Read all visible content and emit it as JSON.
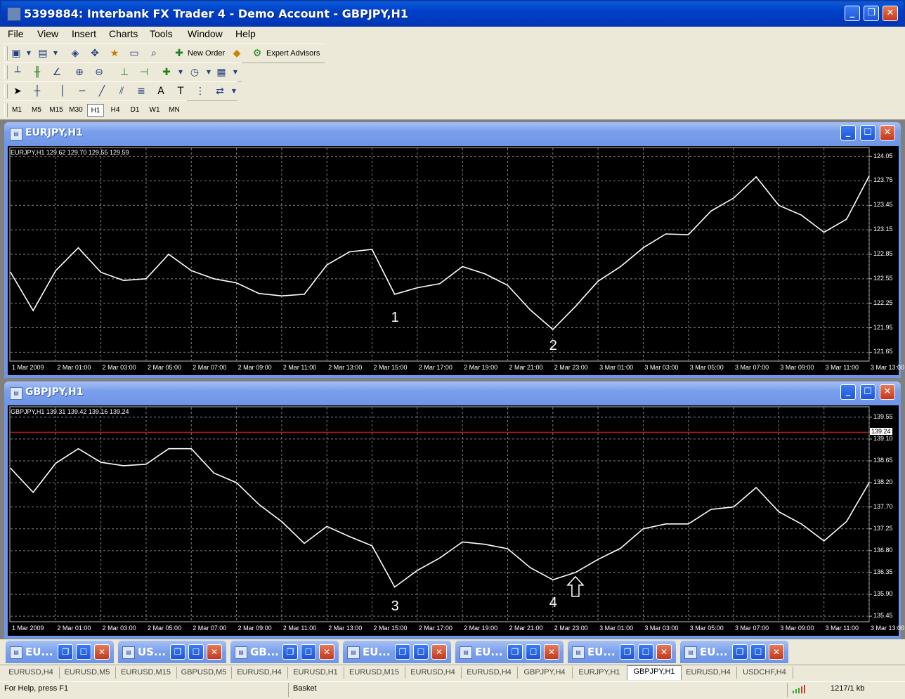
{
  "window": {
    "title": "5399884: Interbank FX Trader 4 - Demo Account - GBPJPY,H1",
    "min_label": "_",
    "restore_label": "❐",
    "close_label": "✕"
  },
  "menu": [
    "File",
    "View",
    "Insert",
    "Charts",
    "Tools",
    "Window",
    "Help"
  ],
  "toolbar1": {
    "new_order_label": "New Order",
    "expert_advisors_label": "Expert Advisors"
  },
  "toolbar_text": {
    "text_tool": "A",
    "text_label_tool": "T"
  },
  "timeframes": [
    "M1",
    "M5",
    "M15",
    "M30",
    "H1",
    "H4",
    "D1",
    "W1",
    "MN"
  ],
  "active_timeframe": "H1",
  "charts": [
    {
      "window_title": "EURJPY,H1",
      "info": "EURJPY,H1  129.62 129.70 129.55 129.59",
      "y_labels": [
        "124.05",
        "123.75",
        "123.45",
        "123.15",
        "122.85",
        "122.55",
        "122.25",
        "121.95",
        "121.65"
      ],
      "x_labels": [
        "1 Mar 2009",
        "2 Mar 01:00",
        "2 Mar 03:00",
        "2 Mar 05:00",
        "2 Mar 07:00",
        "2 Mar 09:00",
        "2 Mar 11:00",
        "2 Mar 13:00",
        "2 Mar 15:00",
        "2 Mar 17:00",
        "2 Mar 19:00",
        "2 Mar 21:00",
        "2 Mar 23:00",
        "3 Mar 01:00",
        "3 Mar 03:00",
        "3 Mar 05:00",
        "3 Mar 07:00",
        "3 Mar 09:00",
        "3 Mar 11:00",
        "3 Mar 13:00"
      ],
      "annotations": [
        "1",
        "2"
      ]
    },
    {
      "window_title": "GBPJPY,H1",
      "info": "GBPJPY,H1  139.31 139.42 139.16 139.24",
      "y_labels": [
        "139.55",
        "139.10",
        "138.65",
        "138.20",
        "137.70",
        "137.25",
        "136.80",
        "136.35",
        "135.90",
        "135.45"
      ],
      "price_tag": "139.24",
      "x_labels": [
        "1 Mar 2009",
        "2 Mar 01:00",
        "2 Mar 03:00",
        "2 Mar 05:00",
        "2 Mar 07:00",
        "2 Mar 09:00",
        "2 Mar 11:00",
        "2 Mar 13:00",
        "2 Mar 15:00",
        "2 Mar 17:00",
        "2 Mar 19:00",
        "2 Mar 21:00",
        "2 Mar 23:00",
        "3 Mar 01:00",
        "3 Mar 03:00",
        "3 Mar 05:00",
        "3 Mar 07:00",
        "3 Mar 09:00",
        "3 Mar 11:00",
        "3 Mar 13:00"
      ],
      "annotations": [
        "3",
        "4"
      ]
    }
  ],
  "chart_data": [
    {
      "type": "line",
      "title": "EURJPY,H1",
      "ylim": [
        121.55,
        124.15
      ],
      "y": [
        122.63,
        122.16,
        122.65,
        122.93,
        122.63,
        122.53,
        122.55,
        122.85,
        122.65,
        122.55,
        122.5,
        122.37,
        122.34,
        122.36,
        122.72,
        122.88,
        122.91,
        122.36,
        122.44,
        122.49,
        122.7,
        122.61,
        122.47,
        122.17,
        121.93,
        122.21,
        122.52,
        122.7,
        122.93,
        123.1,
        123.09,
        123.38,
        123.54,
        123.8,
        123.45,
        123.33,
        123.12,
        123.28,
        123.81
      ]
    },
    {
      "type": "line",
      "title": "GBPJPY,H1",
      "ylim": [
        135.35,
        139.75
      ],
      "y": [
        138.5,
        138.0,
        138.6,
        138.9,
        138.62,
        138.55,
        138.58,
        138.9,
        138.9,
        138.4,
        138.2,
        137.75,
        137.4,
        136.95,
        137.3,
        137.09,
        136.9,
        136.05,
        136.39,
        136.65,
        136.98,
        136.93,
        136.84,
        136.45,
        136.2,
        136.35,
        136.62,
        136.85,
        137.25,
        137.35,
        137.35,
        137.65,
        137.7,
        138.1,
        137.6,
        137.35,
        137.0,
        137.4,
        138.2
      ],
      "price_line": 139.24
    }
  ],
  "minimized_windows": [
    {
      "label": "EU..."
    },
    {
      "label": "US..."
    },
    {
      "label": "GB..."
    },
    {
      "label": "EU..."
    },
    {
      "label": "EU..."
    },
    {
      "label": "EU..."
    },
    {
      "label": "EU..."
    }
  ],
  "tabs": [
    "EURUSD,H4",
    "EURUSD,M5",
    "EURUSD,M15",
    "GBPUSD,M5",
    "EURUSD,H4",
    "EURUSD,H1",
    "EURUSD,M15",
    "EURUSD,H4",
    "EURUSD,H4",
    "GBPJPY,H4",
    "EURJPY,H1",
    "GBPJPY,H1",
    "EURUSD,H4",
    "USDCHF,H4"
  ],
  "active_tab": "GBPJPY,H1",
  "status": {
    "help": "For Help, press F1",
    "profile": "Basket",
    "traffic": "1217/1 kb"
  },
  "colors": {
    "chart_bg": "#000000",
    "line": "#ffffff",
    "grid": "#808080",
    "price_line": "#ff2020"
  }
}
